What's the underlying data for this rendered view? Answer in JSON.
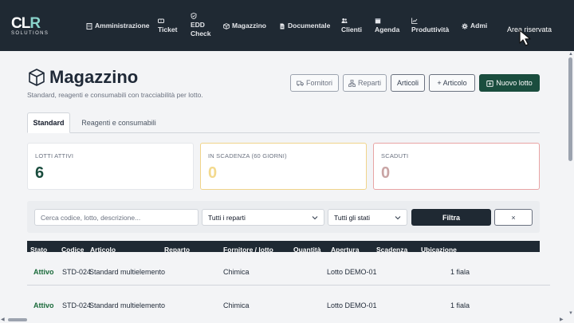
{
  "brand": {
    "logo_text_a": "CL",
    "logo_text_b": "R",
    "logo_sub": "SOLUTIONS"
  },
  "nav": {
    "items": [
      {
        "label": "Amministrazione",
        "icon": "building-icon"
      },
      {
        "label": "Ticket",
        "icon": "ticket-icon"
      },
      {
        "label_lines": [
          "EDD",
          "Check"
        ],
        "icon": "shield-icon"
      },
      {
        "label": "Magazzino",
        "icon": "box-icon"
      },
      {
        "label": "Documentale",
        "icon": "document-icon"
      },
      {
        "label": "Clienti",
        "icon": "people-icon"
      },
      {
        "label": "Agenda",
        "icon": "calendar-icon"
      },
      {
        "label": "Produttività",
        "icon": "chart-line-icon"
      },
      {
        "label": "Admi",
        "icon": "gear-icon"
      }
    ],
    "area_label": "Area riservata"
  },
  "page": {
    "title": "Magazzino",
    "subtitle": "Standard, reagenti e consumabili con tracciabilità per lotto.",
    "buttons": {
      "fornitori": "Fornitori",
      "reparti": "Reparti",
      "articoli": "Articoli",
      "articolo": "+ Articolo",
      "nuovo_lotto": "Nuovo lotto"
    }
  },
  "tabs": [
    {
      "label": "Standard",
      "active": true
    },
    {
      "label": "Reagenti e consumabili",
      "active": false
    }
  ],
  "cards": [
    {
      "label": "LOTTI ATTIVI",
      "value": "6",
      "color": "#1a4d3e"
    },
    {
      "label": "IN SCADENZA (60 GIORNI)",
      "value": "0",
      "color": "#f3d98d"
    },
    {
      "label": "SCADUTI",
      "value": "0",
      "color": "#c9a4a4"
    }
  ],
  "filters": {
    "search_placeholder": "Cerca codice, lotto, descrizione...",
    "reparti_selected": "Tutti i reparti",
    "stati_selected": "Tutti gli stati",
    "filtra_label": "Filtra",
    "clear_label": "×"
  },
  "table": {
    "headers": [
      "Stato",
      "Codice",
      "Articolo",
      "Reparto",
      "Fornitore / lotto",
      "Quantità",
      "Apertura",
      "Scadenza",
      "Ubicazione"
    ],
    "rows": [
      {
        "stato": "Attivo",
        "codice": "STD-024",
        "articolo": "Standard multielemento",
        "reparto": "Chimica",
        "lotto": "Lotto DEMO-01",
        "quantita": "1 fiala"
      },
      {
        "stato": "Attivo",
        "codice": "STD-024",
        "articolo": "Standard multielemento",
        "reparto": "Chimica",
        "lotto": "Lotto DEMO-01",
        "quantita": "1 fiala"
      }
    ]
  },
  "colors": {
    "navbar": "#1f2933",
    "primary": "#1a4d3e",
    "status_active": "#1a6a3a"
  }
}
